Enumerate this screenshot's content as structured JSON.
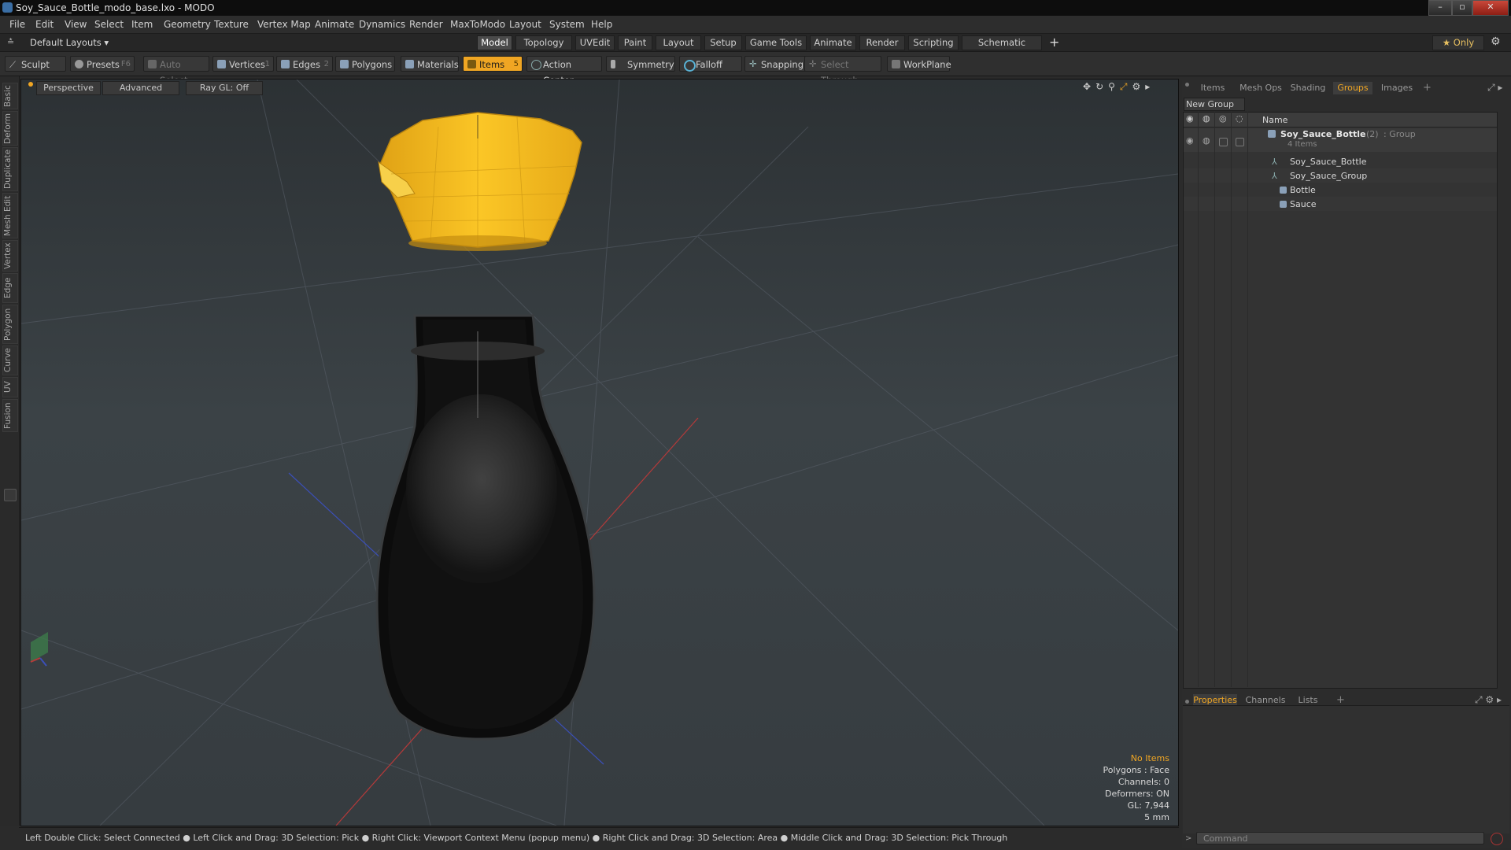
{
  "window": {
    "title": "Soy_Sauce_Bottle_modo_base.lxo - MODO"
  },
  "menu": [
    "File",
    "Edit",
    "View",
    "Select",
    "Item",
    "Geometry",
    "Texture",
    "Vertex Map",
    "Animate",
    "Dynamics",
    "Render",
    "MaxToModo",
    "Layout",
    "System",
    "Help"
  ],
  "layout_selector": "Default Layouts ▾",
  "mode_tabs": [
    "Model",
    "Topology",
    "UVEdit",
    "Paint",
    "Layout",
    "Setup",
    "Game Tools",
    "Animate",
    "Render",
    "Scripting",
    "Schematic Fusion"
  ],
  "mode_active": "Model",
  "add_tab": "+",
  "only_label": "★ Only",
  "tools": {
    "sculpt": "Sculpt",
    "presets": "Presets",
    "presets_key": "F6",
    "auto_select": "Auto Select",
    "vertices": "Vertices",
    "vertices_key": "1",
    "edges": "Edges",
    "edges_key": "2",
    "polygons": "Polygons",
    "materials": "Materials",
    "items": "Items",
    "items_key": "5",
    "action_center": "Action Center",
    "symmetry": "Symmetry",
    "falloff": "Falloff",
    "snapping": "Snapping",
    "select_through": "Select Through",
    "workplane": "WorkPlane"
  },
  "left_tabs": [
    "Basic",
    "Deform",
    "Duplicate",
    "Mesh Edit",
    "Vertex",
    "Edge",
    "Polygon",
    "Curve",
    "UV",
    "Fusion"
  ],
  "viewport": {
    "view": "Perspective",
    "shading": "Advanced",
    "raygl": "Ray GL: Off",
    "info": {
      "no_items": "No Items",
      "polygons": "Polygons : Face",
      "channels": "Channels: 0",
      "deformers": "Deformers: ON",
      "gl": "GL: 7,944",
      "scale": "5 mm"
    }
  },
  "status_bar": "Left Double Click: Select Connected ● Left Click and Drag: 3D Selection: Pick ● Right Click: Viewport Context Menu (popup menu) ● Right Click and Drag: 3D Selection: Area ● Middle Click and Drag: 3D Selection: Pick Through",
  "right_tabs": [
    "Items",
    "Mesh Ops",
    "Shading",
    "Groups",
    "Images"
  ],
  "right_tab_active": "Groups",
  "new_group": "New Group",
  "list_header": "Name",
  "group": {
    "name": "Soy_Sauce_Bottle",
    "count": "(2)",
    "type": ": Group",
    "sub": "4 Items"
  },
  "children": [
    "Soy_Sauce_Bottle",
    "Soy_Sauce_Group",
    "Bottle",
    "Sauce"
  ],
  "bottom_tabs": [
    "Properties",
    "Channels",
    "Lists"
  ],
  "bottom_tab_active": "Properties",
  "command_placeholder": "Command",
  "colors": {
    "accent": "#f0a623",
    "cap": "#f2b51c",
    "bottle": "#0e0e0e"
  }
}
